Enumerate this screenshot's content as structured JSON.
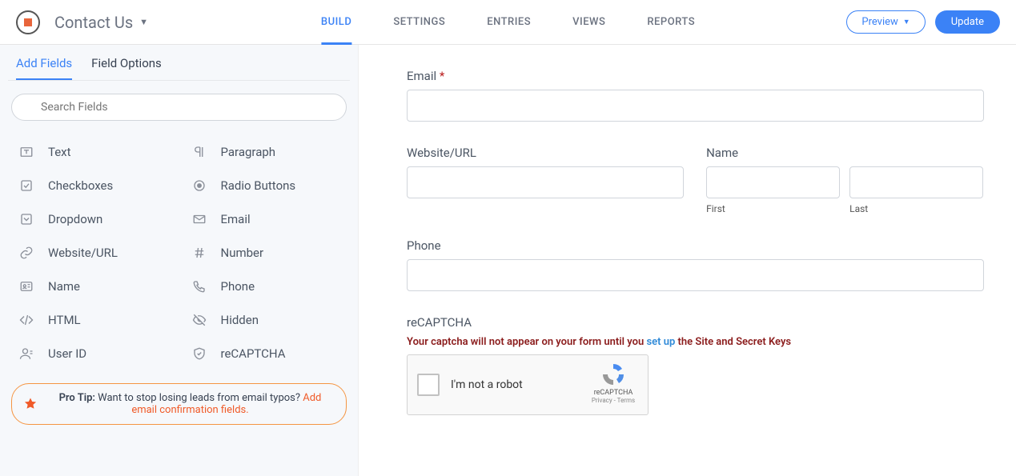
{
  "header": {
    "formName": "Contact Us",
    "tabs": [
      "BUILD",
      "SETTINGS",
      "ENTRIES",
      "VIEWS",
      "REPORTS"
    ],
    "activeTab": 0,
    "previewLabel": "Preview",
    "updateLabel": "Update"
  },
  "sidebar": {
    "tabs": [
      "Add Fields",
      "Field Options"
    ],
    "activeTab": 0,
    "searchPlaceholder": "Search Fields",
    "fields": [
      {
        "label": "Text",
        "icon": "text"
      },
      {
        "label": "Paragraph",
        "icon": "paragraph"
      },
      {
        "label": "Checkboxes",
        "icon": "checkbox"
      },
      {
        "label": "Radio Buttons",
        "icon": "radio"
      },
      {
        "label": "Dropdown",
        "icon": "dropdown"
      },
      {
        "label": "Email",
        "icon": "email"
      },
      {
        "label": "Website/URL",
        "icon": "link"
      },
      {
        "label": "Number",
        "icon": "number"
      },
      {
        "label": "Name",
        "icon": "name"
      },
      {
        "label": "Phone",
        "icon": "phone"
      },
      {
        "label": "HTML",
        "icon": "html"
      },
      {
        "label": "Hidden",
        "icon": "hidden"
      },
      {
        "label": "User ID",
        "icon": "user"
      },
      {
        "label": "reCAPTCHA",
        "icon": "shield"
      }
    ],
    "proTip": {
      "bold": "Pro Tip:",
      "text": " Want to stop losing leads from email typos? ",
      "link": "Add email confirmation fields."
    }
  },
  "canvas": {
    "email": {
      "label": "Email",
      "required": true
    },
    "website": {
      "label": "Website/URL"
    },
    "name": {
      "label": "Name",
      "first": "First",
      "last": "Last"
    },
    "phone": {
      "label": "Phone"
    },
    "recaptcha": {
      "label": "reCAPTCHA",
      "warnPre": "Your captcha will not appear on your form until you ",
      "setup": "set up",
      "warnPost": " the Site and Secret Keys",
      "notRobot": "I'm not a robot",
      "brand": "reCAPTCHA",
      "legal": "Privacy - Terms"
    }
  }
}
